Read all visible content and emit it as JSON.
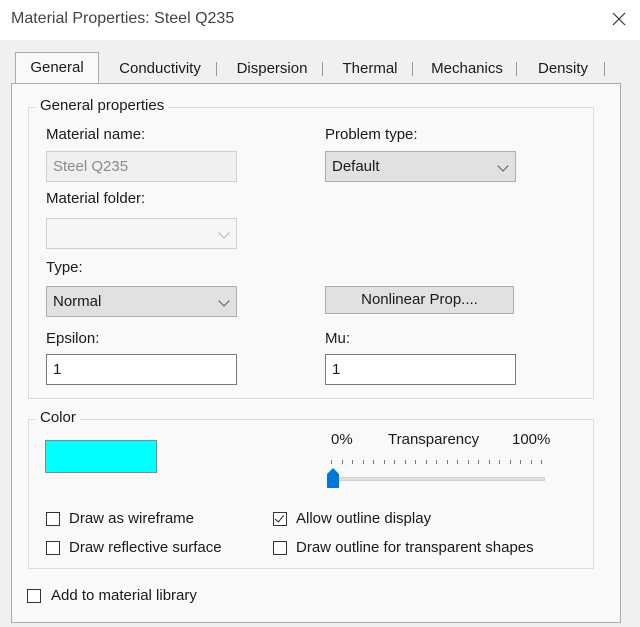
{
  "window": {
    "title": "Material Properties: Steel Q235"
  },
  "tabs": [
    {
      "label": "General",
      "active": true
    },
    {
      "label": "Conductivity",
      "active": false
    },
    {
      "label": "Dispersion",
      "active": false
    },
    {
      "label": "Thermal",
      "active": false
    },
    {
      "label": "Mechanics",
      "active": false
    },
    {
      "label": "Density",
      "active": false
    }
  ],
  "general": {
    "legend": "General properties",
    "material_name_label": "Material name:",
    "material_name_value": "Steel Q235",
    "problem_type_label": "Problem type:",
    "problem_type_value": "Default",
    "material_folder_label": "Material folder:",
    "material_folder_value": "",
    "type_label": "Type:",
    "type_value": "Normal",
    "nonlinear_button": "Nonlinear Prop....",
    "epsilon_label": "Epsilon:",
    "epsilon_value": "1",
    "mu_label": "Mu:",
    "mu_value": "1"
  },
  "color": {
    "legend": "Color",
    "swatch_color": "#00FFFF",
    "transparency_min": "0%",
    "transparency_label": "Transparency",
    "transparency_max": "100%",
    "transparency_value": 0,
    "draw_as_wireframe": {
      "label": "Draw as wireframe",
      "checked": false
    },
    "allow_outline_display": {
      "label": "Allow outline display",
      "checked": true
    },
    "draw_reflective_surface": {
      "label": "Draw reflective surface",
      "checked": false
    },
    "draw_outline_transparent": {
      "label": "Draw outline for transparent shapes",
      "checked": false
    }
  },
  "add_to_library": {
    "label": "Add to material library",
    "checked": false
  },
  "colors": {
    "accent": "#0078D7",
    "window_bg": "#F0F0F0",
    "panel_bg": "#F9F9F9"
  }
}
